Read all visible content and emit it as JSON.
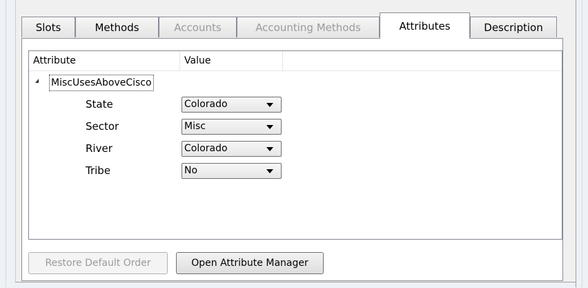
{
  "tabs": [
    {
      "label": "Slots",
      "enabled": true
    },
    {
      "label": "Methods",
      "enabled": true
    },
    {
      "label": "Accounts",
      "enabled": false
    },
    {
      "label": "Accounting Methods",
      "enabled": false
    },
    {
      "label": "Attributes",
      "enabled": true,
      "active": true
    },
    {
      "label": "Description",
      "enabled": true
    }
  ],
  "grid": {
    "columns": [
      "Attribute",
      "Value"
    ],
    "group": "MiscUsesAboveCisco",
    "rows": [
      {
        "attribute": "State",
        "value": "Colorado"
      },
      {
        "attribute": "Sector",
        "value": "Misc"
      },
      {
        "attribute": "River",
        "value": "Colorado"
      },
      {
        "attribute": "Tribe",
        "value": "No"
      }
    ]
  },
  "buttons": {
    "restore": "Restore Default Order",
    "open_manager": "Open Attribute Manager"
  }
}
